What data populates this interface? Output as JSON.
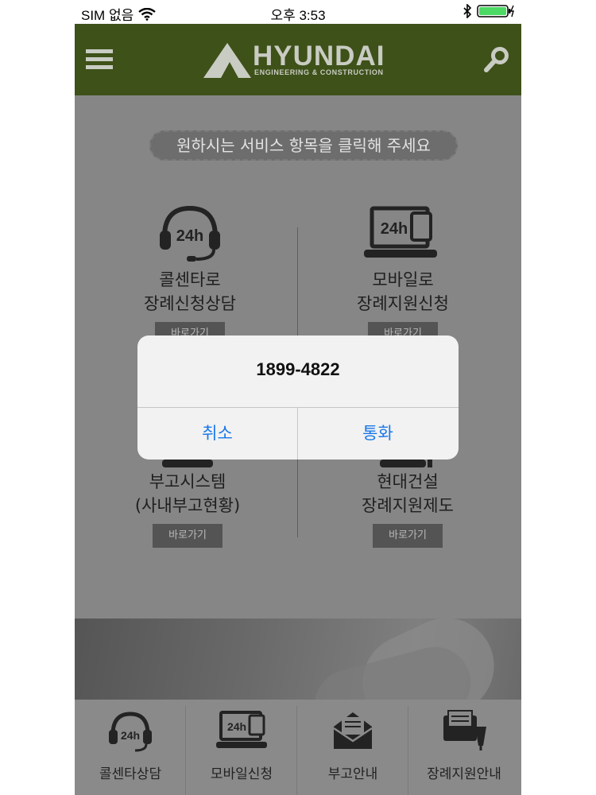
{
  "status_bar": {
    "carrier": "SIM 없음",
    "time": "오후 3:53"
  },
  "header": {
    "logo_word": "HYUNDAI",
    "logo_sub": "ENGINEERING & CONSTRUCTION"
  },
  "guide": "원하시는 서비스 항목을 클릭해 주세요",
  "services": [
    {
      "line1": "콜센타로",
      "line2": "장례신청상담",
      "button": "바로가기",
      "icon_text": "24h"
    },
    {
      "line1": "모바일로",
      "line2": "장례지원신청",
      "button": "바로가기",
      "icon_text": "24h"
    },
    {
      "line1": "부고시스템",
      "line2": "(사내부고현황)",
      "button": "바로가기"
    },
    {
      "line1": "현대건설",
      "line2": "장례지원제도",
      "button": "바로가기"
    }
  ],
  "tabs": [
    {
      "label": "콜센타상담",
      "icon_text": "24h"
    },
    {
      "label": "모바일신청",
      "icon_text": "24h"
    },
    {
      "label": "부고안내"
    },
    {
      "label": "장례지원안내"
    }
  ],
  "alert": {
    "phone": "1899-4822",
    "cancel": "취소",
    "call": "통화"
  },
  "colors": {
    "header": "#3e5119",
    "dim": "#868686",
    "alert_button": "#1a78ea"
  }
}
